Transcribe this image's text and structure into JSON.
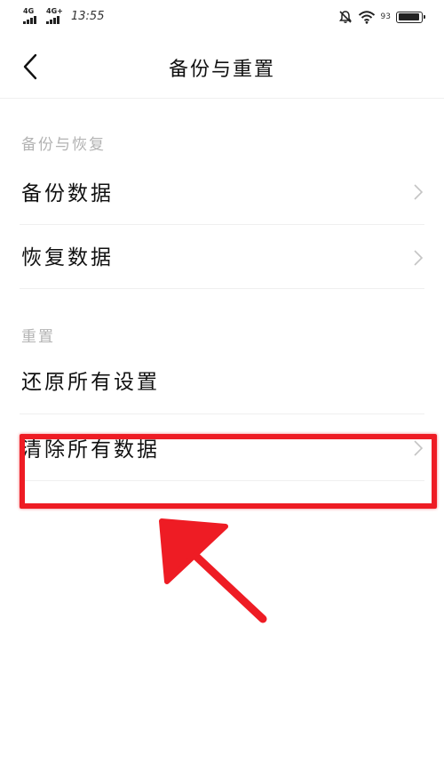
{
  "status_bar": {
    "network1": "4G",
    "network2": "4G+",
    "time": "13:55",
    "battery_percent": "93",
    "battery_level": 0.93,
    "icons": [
      "signal-icon",
      "mute-bell-icon",
      "wifi-icon",
      "battery-icon"
    ]
  },
  "header": {
    "title": "备份与重置",
    "back_icon": "chevron-left-icon"
  },
  "sections": [
    {
      "title": "备份与恢复",
      "items": [
        {
          "label": "备份数据",
          "has_chevron": true
        },
        {
          "label": "恢复数据",
          "has_chevron": true
        }
      ]
    },
    {
      "title": "重置",
      "items": [
        {
          "label": "还原所有设置",
          "has_chevron": false
        },
        {
          "label": "清除所有数据",
          "has_chevron": true
        }
      ]
    }
  ],
  "annotation": {
    "color": "#ee1c24",
    "shapes": [
      "highlight-box",
      "arrow-pointer"
    ]
  }
}
